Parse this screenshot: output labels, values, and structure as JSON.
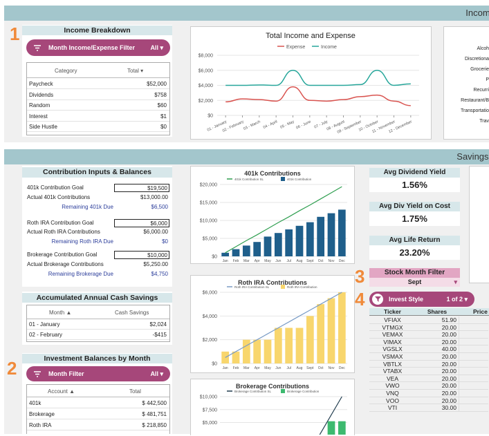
{
  "banners": {
    "income": "Income & Ex",
    "savings": "Savings & Inve"
  },
  "markers": [
    "1",
    "2",
    "3",
    "4"
  ],
  "income_breakdown": {
    "title": "Income Breakdown",
    "filter_label": "Month Income/Expense Filter",
    "filter_value": "All",
    "col_category": "Category",
    "col_total": "Total",
    "rows": [
      {
        "category": "Paycheck",
        "total": "$52,000"
      },
      {
        "category": "Dividends",
        "total": "$758"
      },
      {
        "category": "Random",
        "total": "$60"
      },
      {
        "category": "Interest",
        "total": "$1"
      },
      {
        "category": "Side Hustle",
        "total": "$0"
      }
    ]
  },
  "right_categories": [
    "Alcoh",
    "Discretiona",
    "Grocerie",
    "P",
    "Recurri",
    "Restaurant/B",
    "Transportatio",
    "Trav"
  ],
  "contributions": {
    "title": "Contribution Inputs & Balances",
    "rows": [
      {
        "label": "401k Contribution Goal",
        "value": "$19,500",
        "boxed": true,
        "link": false
      },
      {
        "label": "Actual 401k Contributions",
        "value": "$13,000.00",
        "boxed": false,
        "link": false
      },
      {
        "label": "Remaining 401k Due",
        "value": "$6,500",
        "boxed": false,
        "link": true
      },
      {
        "label": "Roth IRA Contribution Goal",
        "value": "$6,000",
        "boxed": true,
        "link": false
      },
      {
        "label": "Actual Roth IRA Contributions",
        "value": "$6,000.00",
        "boxed": false,
        "link": false
      },
      {
        "label": "Remaining Roth IRA Due",
        "value": "$0",
        "boxed": false,
        "link": true
      },
      {
        "label": "Brokerage Contribution Goal",
        "value": "$10,000",
        "boxed": true,
        "link": false
      },
      {
        "label": "Actual Brokerage Contributions",
        "value": "$5,250.00",
        "boxed": false,
        "link": false
      },
      {
        "label": "Remaining Brokerage Due",
        "value": "$4,750",
        "boxed": false,
        "link": true
      }
    ]
  },
  "cash_savings": {
    "title": "Accumulated Annual Cash Savings",
    "col_month": "Month",
    "col_value": "Cash Savings",
    "rows": [
      {
        "month": "01 - January",
        "value": "$2,024"
      },
      {
        "month": "02 - February",
        "value": "-$415"
      }
    ]
  },
  "investment_balances": {
    "title": "Investment Balances by Month",
    "filter_label": "Month Filter",
    "filter_value": "All",
    "col_account": "Account",
    "col_total": "Total",
    "rows": [
      {
        "account": "401k",
        "total": "$ 442,500"
      },
      {
        "account": "Brokerage",
        "total": "$ 481,751"
      },
      {
        "account": "Roth IRA",
        "total": "$ 218,850"
      }
    ]
  },
  "stats": [
    {
      "label": "Avg Dividend Yield",
      "value": "1.56%"
    },
    {
      "label": "Avg Div Yield on Cost",
      "value": "1.75%"
    },
    {
      "label": "Avg Life Return",
      "value": "23.20%"
    }
  ],
  "stock_filter": {
    "title": "Stock Month Filter",
    "value": "Sept"
  },
  "invest_style": {
    "label": "Invest Style",
    "value": "1 of 2"
  },
  "stocks": {
    "col_ticker": "Ticker",
    "col_shares": "Shares",
    "col_price": "Price",
    "rows": [
      {
        "ticker": "VFIAX",
        "shares": "51.90"
      },
      {
        "ticker": "VTMGX",
        "shares": "20.00"
      },
      {
        "ticker": "VEMAX",
        "shares": "20.00"
      },
      {
        "ticker": "VIMAX",
        "shares": "20.00"
      },
      {
        "ticker": "VGSLX",
        "shares": "40.00"
      },
      {
        "ticker": "VSMAX",
        "shares": "20.00"
      },
      {
        "ticker": "VBTLX",
        "shares": "20.00"
      },
      {
        "ticker": "VTABX",
        "shares": "20.00"
      },
      {
        "ticker": "VEA",
        "shares": "20.00"
      },
      {
        "ticker": "VWO",
        "shares": "20.00"
      },
      {
        "ticker": "VNQ",
        "shares": "20.00"
      },
      {
        "ticker": "VOO",
        "shares": "20.00"
      },
      {
        "ticker": "VTI",
        "shares": "30.00"
      }
    ]
  },
  "colors": {
    "banner": "#a3c6cc",
    "accent": "#a6477a",
    "marker": "#f08a3a",
    "bar401k": "#1f5f8b",
    "barRoth": "#f8d66d",
    "barBrok": "#3dba6f",
    "line": "#2e9e4f"
  },
  "chart_data": [
    {
      "type": "line",
      "title": "Total Income and Expense",
      "categories": [
        "01 - January",
        "02 - February",
        "03 - March",
        "04 - April",
        "05 - May",
        "06 - June",
        "07 - July",
        "08 - August",
        "09 - September",
        "10 - October",
        "11 - November",
        "12 - December"
      ],
      "series": [
        {
          "name": "Expense",
          "values": [
            1800,
            2200,
            2100,
            1900,
            3800,
            2000,
            1900,
            2100,
            2500,
            2700,
            1900,
            1300
          ]
        },
        {
          "name": "Income",
          "values": [
            4000,
            4000,
            4050,
            4000,
            6000,
            4000,
            4000,
            4000,
            4100,
            6000,
            4000,
            4200
          ]
        }
      ],
      "yticks": [
        "$0",
        "$2,000",
        "$4,000",
        "$6,000",
        "$8,000"
      ],
      "ylim": [
        0,
        8000
      ]
    },
    {
      "type": "bar",
      "title": "401k Contributions",
      "categories": [
        "Jan",
        "Feb",
        "Mar",
        "Apr",
        "May",
        "Jun",
        "Jul",
        "Aug",
        "Sept",
        "Oct",
        "Nov",
        "Dec"
      ],
      "series": [
        {
          "name": "401k Contribution SL",
          "type": "line",
          "values": [
            1000,
            2700,
            4400,
            6000,
            7700,
            9400,
            11000,
            12700,
            14300,
            16000,
            17700,
            19400
          ]
        },
        {
          "name": "401k Contribution",
          "values": [
            1000,
            2000,
            3000,
            4000,
            5500,
            6500,
            7500,
            8500,
            9500,
            11000,
            12000,
            13000
          ]
        }
      ],
      "yticks": [
        "$0",
        "$5,000",
        "$10,000",
        "$15,000",
        "$20,000"
      ],
      "ylim": [
        0,
        20000
      ]
    },
    {
      "type": "bar",
      "title": "Roth IRA Contributions",
      "categories": [
        "Jan",
        "Feb",
        "Mar",
        "Apr",
        "May",
        "Jun",
        "Jul",
        "Aug",
        "Sept",
        "Oct",
        "Nov",
        "Dec"
      ],
      "series": [
        {
          "name": "Roth IRA Contribution SL",
          "type": "line",
          "values": [
            500,
            1000,
            1500,
            2000,
            2500,
            3000,
            3500,
            4000,
            4500,
            5000,
            5500,
            6000
          ]
        },
        {
          "name": "Roth IRA Contribution",
          "values": [
            1000,
            1000,
            2000,
            2000,
            2000,
            3000,
            3000,
            3000,
            4000,
            5000,
            5500,
            6000
          ]
        }
      ],
      "yticks": [
        "$0",
        "$2,000",
        "$4,000",
        "$6,000"
      ],
      "ylim": [
        0,
        6000
      ]
    },
    {
      "type": "bar",
      "title": "Brokerage Contributions",
      "categories": [
        "Jan",
        "Feb",
        "Mar",
        "Apr",
        "May",
        "Jun",
        "Jul",
        "Aug",
        "Sept",
        "Oct",
        "Nov",
        "Dec"
      ],
      "series": [
        {
          "name": "Brokerage Contribution SL",
          "type": "line",
          "values": [
            0,
            0,
            0,
            0,
            0,
            0,
            0,
            0,
            0,
            7500,
            9000,
            11000
          ]
        },
        {
          "name": "Brokerage Contribution",
          "values": [
            0,
            0,
            0,
            0,
            0,
            0,
            0,
            0,
            0,
            0,
            5250,
            5250
          ]
        }
      ],
      "yticks": [
        "$5,000",
        "$7,500",
        "$10,000"
      ],
      "ylim": [
        0,
        10000
      ]
    }
  ]
}
